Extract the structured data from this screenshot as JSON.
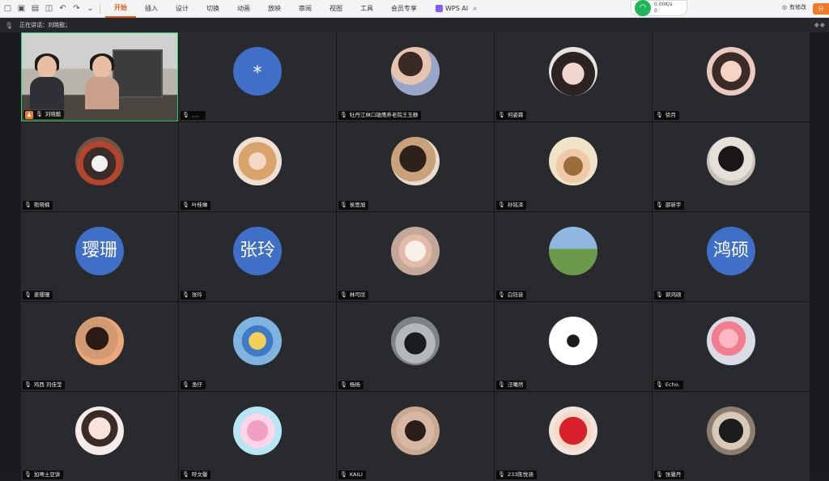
{
  "toolbar": {
    "menu": [
      {
        "label": "开始",
        "active": true
      },
      {
        "label": "插入",
        "active": false
      },
      {
        "label": "设计",
        "active": false
      },
      {
        "label": "切换",
        "active": false
      },
      {
        "label": "动画",
        "active": false
      },
      {
        "label": "放映",
        "active": false
      },
      {
        "label": "审阅",
        "active": false
      },
      {
        "label": "视图",
        "active": false
      },
      {
        "label": "工具",
        "active": false
      },
      {
        "label": "会员专享",
        "active": false
      }
    ],
    "wps_ai": "WPS AI",
    "network": {
      "up": "0.00K/s",
      "down": "0"
    },
    "edit_label": "有修改",
    "share_label": "分"
  },
  "speaking": {
    "label": "正在讲话：刘晓懿；"
  },
  "participants": [
    {
      "name": "刘晓懿",
      "type": "video",
      "host": true
    },
    {
      "name": "．．．",
      "type": "text",
      "avatar_text": "*"
    },
    {
      "name": "牡丹江林口雄鹰养老院王玉静",
      "type": "photo",
      "photo": "p1"
    },
    {
      "name": "何姿霖",
      "type": "photo",
      "photo": "p2"
    },
    {
      "name": "徐月",
      "type": "photo",
      "photo": "p3"
    },
    {
      "name": "熊晓楠",
      "type": "photo",
      "photo": "p4"
    },
    {
      "name": "叶桂琳",
      "type": "photo",
      "photo": "p5"
    },
    {
      "name": "侯思旭",
      "type": "photo",
      "photo": "p6"
    },
    {
      "name": "孙铭泽",
      "type": "photo",
      "photo": "p7"
    },
    {
      "name": "邵新宇",
      "type": "photo",
      "photo": "p8"
    },
    {
      "name": "姜璎珊",
      "type": "text",
      "avatar_text": "璎珊"
    },
    {
      "name": "张玲",
      "type": "text",
      "avatar_text": "张玲"
    },
    {
      "name": "林可欣",
      "type": "photo",
      "photo": "p9"
    },
    {
      "name": "白钰音",
      "type": "photo",
      "photo": "p10"
    },
    {
      "name": "郭鸿硕",
      "type": "text",
      "avatar_text": "鸿硕"
    },
    {
      "name": "鸡西 刘佳莹",
      "type": "photo",
      "photo": "p11"
    },
    {
      "name": "渔仔",
      "type": "photo",
      "photo": "p12"
    },
    {
      "name": "杨杨",
      "type": "photo",
      "photo": "p13"
    },
    {
      "name": "汪曦然",
      "type": "photo",
      "photo": "p14"
    },
    {
      "name": "Echo.",
      "type": "photo",
      "photo": "p15"
    },
    {
      "name": "加啤土豆饼",
      "type": "photo",
      "photo": "p16"
    },
    {
      "name": "呼文馨",
      "type": "photo",
      "photo": "p17"
    },
    {
      "name": "KAILI",
      "type": "photo",
      "photo": "p18"
    },
    {
      "name": "233陈悦涵",
      "type": "photo",
      "photo": "p19"
    },
    {
      "name": "张馨丹",
      "type": "photo",
      "photo": "p20"
    }
  ],
  "colors": {
    "accent": "#e35d1a",
    "avatar_blue": "#3f6fc6",
    "active_speaker": "#2ed169",
    "tile_bg": "#292a2e"
  }
}
